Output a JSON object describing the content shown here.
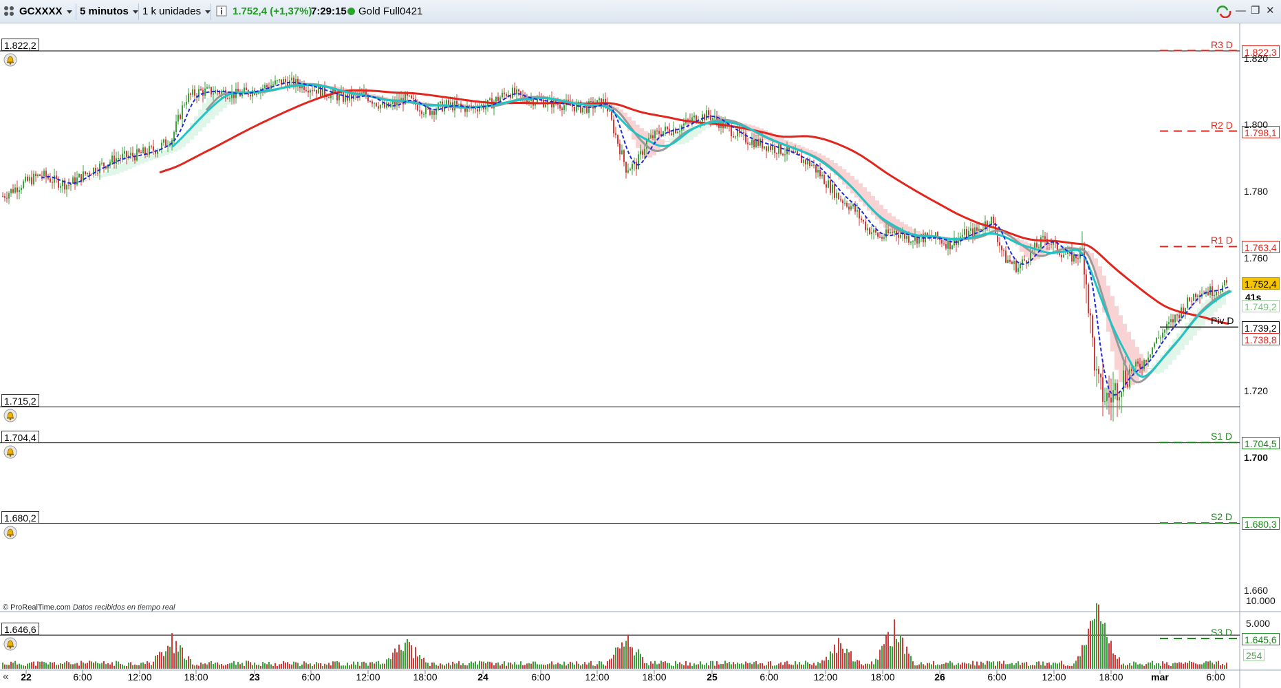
{
  "toolbar": {
    "instrument": "GCXXXX",
    "timeframe": "5 minutos",
    "units": "1 k unidades",
    "last_price": "1.752,4 (+1,37%)",
    "time": "7:29:15",
    "contract": "Gold Full0421",
    "status_color": "#2aa52a"
  },
  "levels": [
    {
      "id": "r3",
      "name": "R3 D",
      "value": "1.822,3",
      "color": "#e0261d",
      "style": "dashed"
    },
    {
      "id": "r2",
      "name": "R2 D",
      "value": "1.798,1",
      "color": "#e0261d",
      "style": "dashed"
    },
    {
      "id": "r1",
      "name": "R1 D",
      "value": "1.763,4",
      "color": "#e0261d",
      "style": "dashed"
    },
    {
      "id": "piv",
      "name": "Piv D",
      "value": "1.739,2",
      "color": "#000000",
      "style": "solid"
    },
    {
      "id": "s1",
      "name": "S1 D",
      "value": "1.704,5",
      "color": "#1a8a1a",
      "style": "dashed"
    },
    {
      "id": "s2",
      "name": "S2 D",
      "value": "1.680,3",
      "color": "#1a8a1a",
      "style": "dashed"
    },
    {
      "id": "s3",
      "name": "S3 D",
      "value": "1.645,6",
      "color": "#1a8a1a",
      "style": "dashed"
    }
  ],
  "alerts": [
    {
      "value": "1.822,2"
    },
    {
      "value": "1.715,2"
    },
    {
      "value": "1.704,4"
    },
    {
      "value": "1.680,2"
    },
    {
      "value": "1.646,6"
    }
  ],
  "price_axis": {
    "ticks": [
      "1.820",
      "1.800",
      "1.780",
      "1.760",
      "1.720",
      "1.700",
      "1.660"
    ],
    "current_price": "1.752,4",
    "current_price_bg": "#f5c400",
    "countdown": "41s",
    "indicator_1": "1.749,2",
    "indicator_2": "1.738,8"
  },
  "volume_axis": {
    "ticks": [
      "10.000",
      "5.000"
    ],
    "current": "254"
  },
  "time_axis": {
    "labels": [
      "22",
      "6:00",
      "12:00",
      "18:00",
      "23",
      "6:00",
      "12:00",
      "18:00",
      "24",
      "6:00",
      "12:00",
      "18:00",
      "25",
      "6:00",
      "12:00",
      "18:00",
      "26",
      "6:00",
      "12:00",
      "18:00",
      "mar",
      "6:00"
    ]
  },
  "footer": {
    "brand": "© ProRealTime.com",
    "note": "Datos recibidos en tiempo real"
  },
  "colors": {
    "ma_red": "#e0261d",
    "ma_cyan": "#20c4c4",
    "ma_grey": "#999999",
    "ma_blue": "#1c2ad8",
    "cloud_pink": "#f8c8c8",
    "cloud_green": "#d8f4e4"
  },
  "chart_data": {
    "type": "line",
    "price_range": [
      1640,
      1830
    ],
    "series": [
      {
        "color": "#000000",
        "x": [
          0,
          30,
          60,
          90,
          120,
          150,
          180,
          210,
          240,
          270,
          300,
          330,
          360,
          390,
          420,
          450,
          480,
          500,
          515,
          530,
          545,
          560,
          575,
          590,
          610
        ],
        "y": [
          1778,
          1782,
          1785,
          1782,
          1787,
          1793,
          1797,
          1812,
          1809,
          1810,
          1813,
          1810,
          1806,
          1808,
          1805,
          1807,
          1810,
          1800,
          1782,
          1793,
          1798,
          1800,
          1802,
          1801,
          1803
        ]
      },
      {
        "color": "#20c4c4",
        "x": [
          70,
          90,
          110,
          130,
          150,
          170,
          190,
          210,
          230,
          250,
          270,
          290,
          300,
          330,
          360,
          390,
          420,
          450,
          470,
          480,
          500,
          520,
          540,
          560,
          575,
          585,
          595,
          605,
          612
        ],
        "y": [
          1790,
          1806,
          1810,
          1810,
          1805,
          1806,
          1810,
          1810,
          1805,
          1802,
          1805,
          1802,
          1800,
          1794,
          1790,
          1782,
          1775,
          1770,
          1768,
          1766,
          1762,
          1748,
          1728,
          1718,
          1718,
          1724,
          1735,
          1745,
          1750
        ]
      },
      {
        "color": "#e0261d",
        "x": [
          80,
          120,
          160,
          200,
          240,
          280,
          300,
          330,
          370,
          400,
          420,
          440,
          460,
          480,
          500,
          530,
          560,
          585,
          610
        ],
        "y": [
          1788,
          1800,
          1808,
          1808,
          1806,
          1808,
          1806,
          1801,
          1798,
          1789,
          1782,
          1775,
          1768,
          1765,
          1762,
          1750,
          1742,
          1740,
          1738
        ]
      }
    ],
    "volume_ticks": [
      "10.000",
      "5.000"
    ]
  }
}
